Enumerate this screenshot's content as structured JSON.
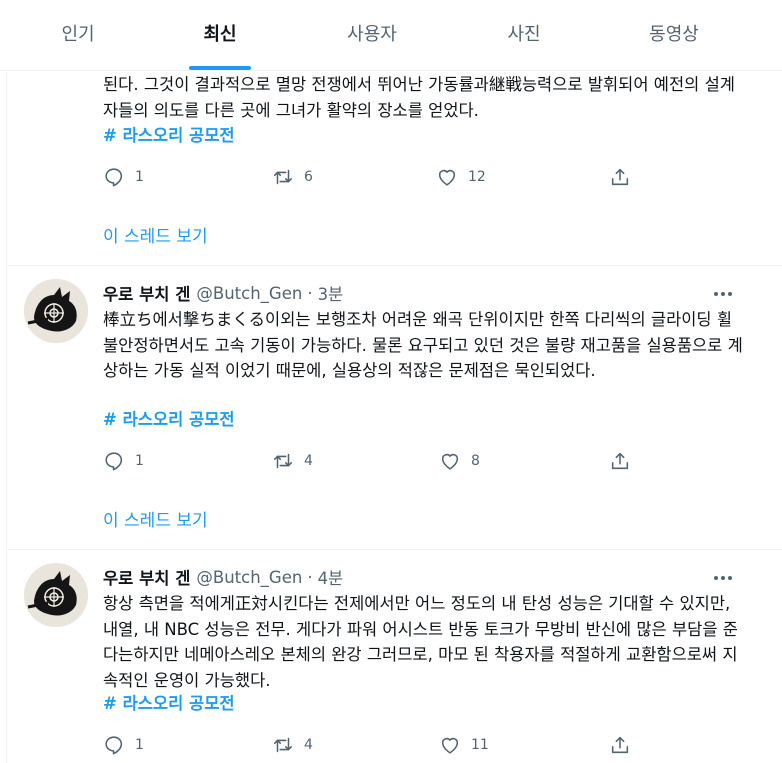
{
  "tabs": [
    {
      "label": "인기"
    },
    {
      "label": "최신"
    },
    {
      "label": "사용자"
    },
    {
      "label": "사진"
    },
    {
      "label": "동영상"
    }
  ],
  "active_tab": "최신",
  "thread_link_label": "이 스레드 보기",
  "tweets": [
    {
      "text": "된다. 그것이 결과적으로 멸망 전쟁에서 뛰어난 가동률과継戦능력으로 발휘되어 예전의 설계자들의 의도를 다른 곳에 그녀가 활약의 장소를 얻었다.",
      "hashtag": "# 라스오리 공모전",
      "replies": "1",
      "retweets": "6",
      "likes": "12"
    },
    {
      "name": "우로 부치 겐",
      "handle": "@Butch_Gen",
      "time": "3분",
      "text": "棒立ち에서撃ちまくる이외는 보행조차 어려운 왜곡 단위이지만 한쪽 다리씩의 글라이딩 휠 불안정하면서도 고속 기동이 가능하다. 물론 요구되고 있던 것은 불량 재고품을 실용품으로 계상하는 가동 실적 이었기 때문에, 실용상의 적잖은 문제점은 묵인되었다.",
      "hashtag": "# 라스오리 공모전",
      "replies": "1",
      "retweets": "4",
      "likes": "8"
    },
    {
      "name": "우로 부치 겐",
      "handle": "@Butch_Gen",
      "time": "4분",
      "text": "항상 측면을 적에게正対시킨다는 전제에서만 어느 정도의 내 탄성 성능은 기대할 수 있지만, 내열, 내 NBC 성능은 전무. 게다가 파워 어시스트 반동 토크가 무방비 반신에 많은 부담을 준다는하지만 네메아스레오 본체의 완강 그러므로, 마모 된 착용자를 적절하게 교환함으로써 지속적인 운영이 가능했다.",
      "hashtag": "# 라스오리 공모전",
      "replies": "1",
      "retweets": "4",
      "likes": "11"
    }
  ],
  "colors": {
    "accent": "#1d9bf0",
    "text": "#0f1419",
    "muted": "#536471",
    "border": "#eff3f4"
  }
}
